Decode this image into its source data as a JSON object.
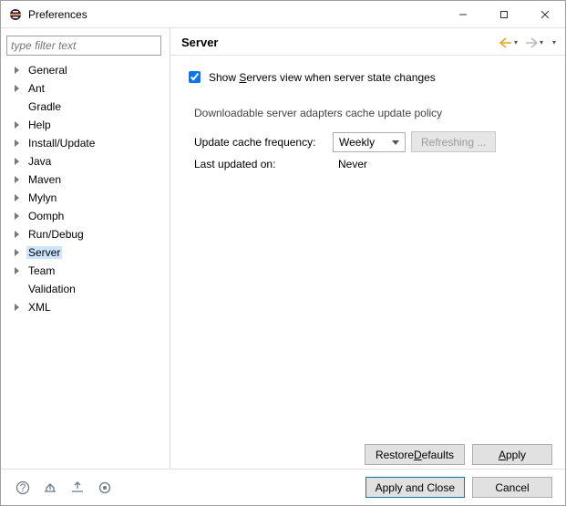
{
  "window": {
    "title": "Preferences"
  },
  "sidebar": {
    "filter_placeholder": "type filter text",
    "items": [
      {
        "label": "General",
        "expandable": true
      },
      {
        "label": "Ant",
        "expandable": true
      },
      {
        "label": "Gradle",
        "expandable": false
      },
      {
        "label": "Help",
        "expandable": true
      },
      {
        "label": "Install/Update",
        "expandable": true
      },
      {
        "label": "Java",
        "expandable": true
      },
      {
        "label": "Maven",
        "expandable": true
      },
      {
        "label": "Mylyn",
        "expandable": true
      },
      {
        "label": "Oomph",
        "expandable": true
      },
      {
        "label": "Run/Debug",
        "expandable": true
      },
      {
        "label": "Server",
        "expandable": true,
        "selected": true
      },
      {
        "label": "Team",
        "expandable": true
      },
      {
        "label": "Validation",
        "expandable": false
      },
      {
        "label": "XML",
        "expandable": true
      }
    ]
  },
  "header": {
    "title": "Server"
  },
  "main": {
    "show_servers_prefix": "Show ",
    "show_servers_access": "S",
    "show_servers_suffix": "ervers view when server state changes",
    "show_servers_checked": true,
    "group_title": "Downloadable server adapters cache update policy",
    "update_label": "Update cache frequency:",
    "update_value": "Weekly",
    "refresh_label": "Refreshing ...",
    "last_updated_label": "Last updated on:",
    "last_updated_value": "Never"
  },
  "buttons": {
    "restore_prefix": "Restore ",
    "restore_access": "D",
    "restore_suffix": "efaults",
    "apply_access": "A",
    "apply_suffix": "pply",
    "apply_close": "Apply and Close",
    "cancel": "Cancel"
  }
}
